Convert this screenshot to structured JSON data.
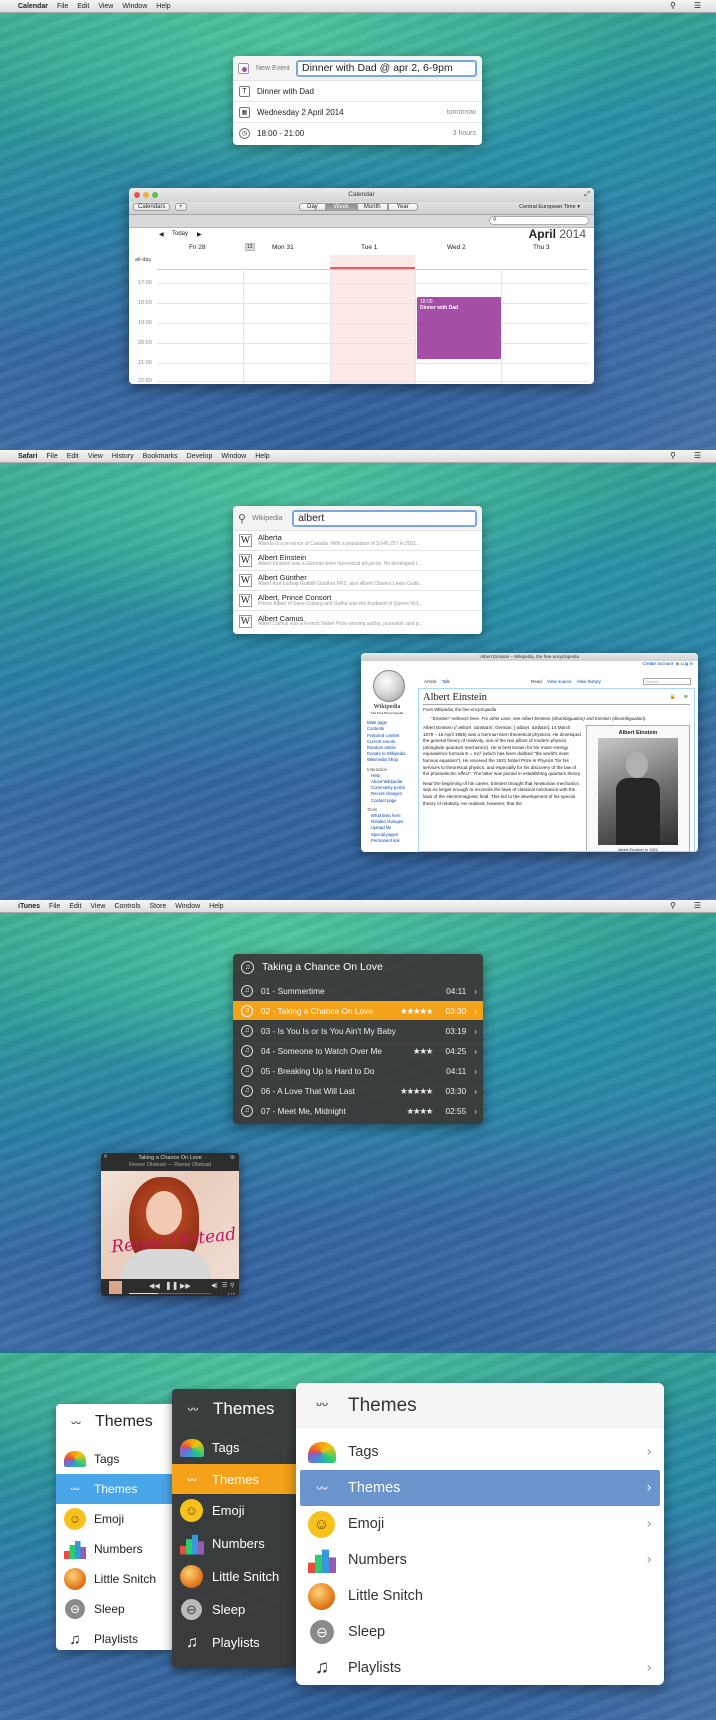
{
  "calendar": {
    "menubar": {
      "app": "Calendar",
      "items": [
        "File",
        "Edit",
        "View",
        "Window",
        "Help"
      ]
    },
    "new_event": {
      "label": "New Event",
      "input": "Dinner with Dad @ apr 2, 6-9pm",
      "title": "Dinner with Dad",
      "date": "Wednesday 2 April 2014",
      "date_hint": "tomorrow",
      "time": "18:00 - 21:00",
      "duration": "3 hours"
    },
    "window": {
      "title": "Calendar",
      "calendars_btn": "Calendars",
      "add_btn": "+",
      "views": [
        "Day",
        "Week",
        "Month",
        "Year"
      ],
      "active_view": "Week",
      "timezone": "Central European Time",
      "today_btn": "Today",
      "month": "April",
      "year": "2014",
      "days": [
        "Fri 28",
        "Mon 31",
        "Tue 1",
        "Wed 2",
        "Thu 3"
      ],
      "badge": "13",
      "allday": "all-day",
      "hours": [
        "17:00",
        "18:00",
        "19:00",
        "20:00",
        "21:00",
        "22:00"
      ],
      "event_time": "18:00",
      "event_title": "Dinner with Dad",
      "event_color": "#a44ea8"
    }
  },
  "safari": {
    "menubar": {
      "app": "Safari",
      "items": [
        "File",
        "Edit",
        "View",
        "History",
        "Bookmarks",
        "Develop",
        "Window",
        "Help"
      ]
    },
    "search": {
      "provider": "Wikipedia",
      "query": "albert"
    },
    "results": [
      {
        "title": "Alberta",
        "desc": "Alberta is a province of Canada. With a population of 3,645,257 in 2011..."
      },
      {
        "title": "Albert Einstein",
        "desc": "Albert Einstein was a German-born theoretical physicist. He developed t..."
      },
      {
        "title": "Albert Günther",
        "desc": "Albert Karl Ludwig Gotthilf Günther FRS, also Albert Charles Lewis Gotth..."
      },
      {
        "title": "Albert, Prince Consort",
        "desc": "Prince Albert of Saxe-Coburg and Gotha was the husband of Queen Vict..."
      },
      {
        "title": "Albert Camus",
        "desc": "Albert Camus was a French Nobel Prize winning author, journalist, and p..."
      }
    ],
    "page": {
      "title": "Albert Einstein – Wikipedia, the free encyclopedia",
      "create": "Create account",
      "login": "Log in",
      "tabs": [
        "Article",
        "Talk"
      ],
      "actions": [
        "Read",
        "View source",
        "View history"
      ],
      "search_ph": "Search",
      "heading": "Albert Einstein",
      "from": "From Wikipedia, the free encyclopedia",
      "hatnote": "\"Einstein\" redirects here. For other uses, see Albert Einstein (disambiguation) and Einstein (disambiguation).",
      "wiki_name": "Wikipedia",
      "wiki_sub": "The Free Encyclopedia",
      "nav": [
        "Main page",
        "Contents",
        "Featured content",
        "Current events",
        "Random article",
        "Donate to Wikipedia",
        "Wikimedia Shop"
      ],
      "interaction_head": "Interaction",
      "interaction": [
        "Help",
        "About Wikipedia",
        "Community portal",
        "Recent changes",
        "Contact page"
      ],
      "tools_head": "Tools",
      "tools": [
        "What links here",
        "Related changes",
        "Upload file",
        "Special pages",
        "Permanent link"
      ],
      "p1": "Albert Einstein (/ˈælbərt ˈaɪnstaɪn/; German: [ˈalbɛɐ̯t ˈaɪnʃtaɪn]; 14 March 1879 – 18 April 1955) was a German-born theoretical physicist. He developed the general theory of relativity, one of the two pillars of modern physics (alongside quantum mechanics). He is best known for his mass–energy equivalence formula E = mc² (which has been dubbed \"the world's most famous equation\"). He received the 1921 Nobel Prize in Physics \"for his services to theoretical physics, and especially for his discovery of the law of the photoelectric effect\". The latter was pivotal in establishing quantum theory.",
      "p2": "Near the beginning of his career, Einstein thought that Newtonian mechanics was no longer enough to reconcile the laws of classical mechanics with the laws of the electromagnetic field. This led to the development of his special theory of relativity. He realized, however, that the",
      "infobox_title": "Albert Einstein",
      "caption": "Albert Einstein in 1921"
    }
  },
  "itunes": {
    "menubar": {
      "app": "iTunes",
      "items": [
        "File",
        "Edit",
        "View",
        "Controls",
        "Store",
        "Window",
        "Help"
      ]
    },
    "album": "Taking a Chance On Love",
    "tracks": [
      {
        "title": "01 - Summertime",
        "stars": "",
        "dur": "04:11"
      },
      {
        "title": "02 - Taking a Chance On Love",
        "stars": "★★★★★",
        "dur": "03:30"
      },
      {
        "title": "03 - Is You Is or Is You Ain't My Baby",
        "stars": "",
        "dur": "03:19"
      },
      {
        "title": "04 - Someone to Watch Over Me",
        "stars": "★★★",
        "dur": "04:25"
      },
      {
        "title": "05 - Breaking Up Is Hard to Do",
        "stars": "",
        "dur": "04:11"
      },
      {
        "title": "06 - A Love That Will Last",
        "stars": "★★★★★",
        "dur": "03:30"
      },
      {
        "title": "07 - Meet Me, Midnight",
        "stars": "★★★★",
        "dur": "02:55"
      }
    ],
    "active_index": 1,
    "accent": "#f5a21b",
    "mini": {
      "title": "Taking a Chance On Love",
      "artist": "Renee Olstead — Renee Olstead",
      "cover_text": "Renee Olstead",
      "time": "1:10",
      "progress": 0.35
    }
  },
  "themes": {
    "title": "Themes",
    "items": [
      "Tags",
      "Themes",
      "Emoji",
      "Numbers",
      "Little Snitch",
      "Sleep",
      "Playlists"
    ],
    "active_index": 1,
    "accent_light": "#49a6e8",
    "accent_dark": "#f5a21b",
    "accent_large": "#6b94cc"
  }
}
